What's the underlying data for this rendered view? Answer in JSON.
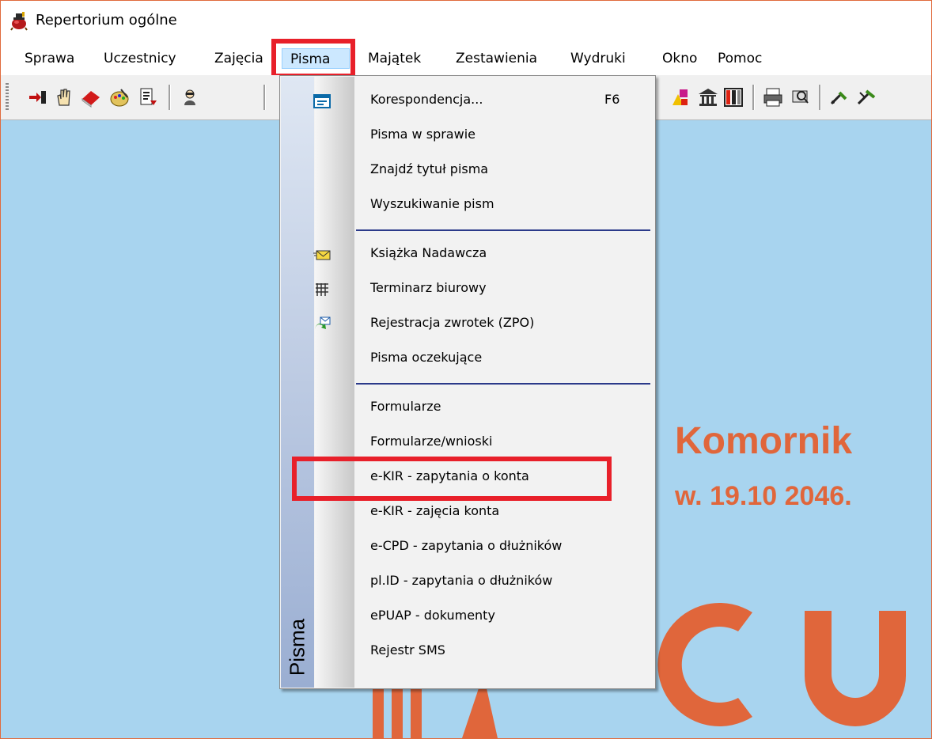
{
  "window": {
    "title": "Repertorium ogólne"
  },
  "menubar": {
    "items": [
      {
        "label": "Sprawa"
      },
      {
        "label": "Uczestnicy"
      },
      {
        "label": "Zajęcia"
      },
      {
        "label": "Pisma",
        "active": true
      },
      {
        "label": "Majątek"
      },
      {
        "label": "Zestawienia"
      },
      {
        "label": "Wydruki"
      },
      {
        "label": "Okno"
      },
      {
        "label": "Pomoc"
      }
    ]
  },
  "dropdown": {
    "side_label": "Pisma",
    "items": [
      {
        "label": "Korespondencja...",
        "shortcut": "F6",
        "icon": "letter-icon"
      },
      {
        "label": "Pisma w sprawie"
      },
      {
        "label": "Znajdź tytuł pisma"
      },
      {
        "label": "Wyszukiwanie pism"
      },
      {
        "label": "Książka Nadawcza",
        "icon": "envelope-icon"
      },
      {
        "label": "Terminarz biurowy",
        "icon": "calendar-grid-icon"
      },
      {
        "label": "Rejestracja zwrotek (ZPO)",
        "icon": "return-receipt-icon"
      },
      {
        "label": "Pisma oczekujące"
      },
      {
        "label": "Formularze"
      },
      {
        "label": "Formularze/wnioski"
      },
      {
        "label": "e-KIR - zapytania o konta",
        "highlighted": true
      },
      {
        "label": "e-KIR - zajęcia konta"
      },
      {
        "label": "e-CPD - zapytania o dłużników"
      },
      {
        "label": "pl.ID - zapytania o dłużników"
      },
      {
        "label": "ePUAP - dokumenty"
      },
      {
        "label": "Rejestr SMS"
      }
    ]
  },
  "workspace": {
    "line1": "Komornik",
    "line2": "w. 19.10 2046."
  },
  "colors": {
    "workspace_bg": "#a8d4ef",
    "brand": "#e0663b",
    "highlight_box": "#e8202a",
    "menu_active": "#cce8ff"
  }
}
